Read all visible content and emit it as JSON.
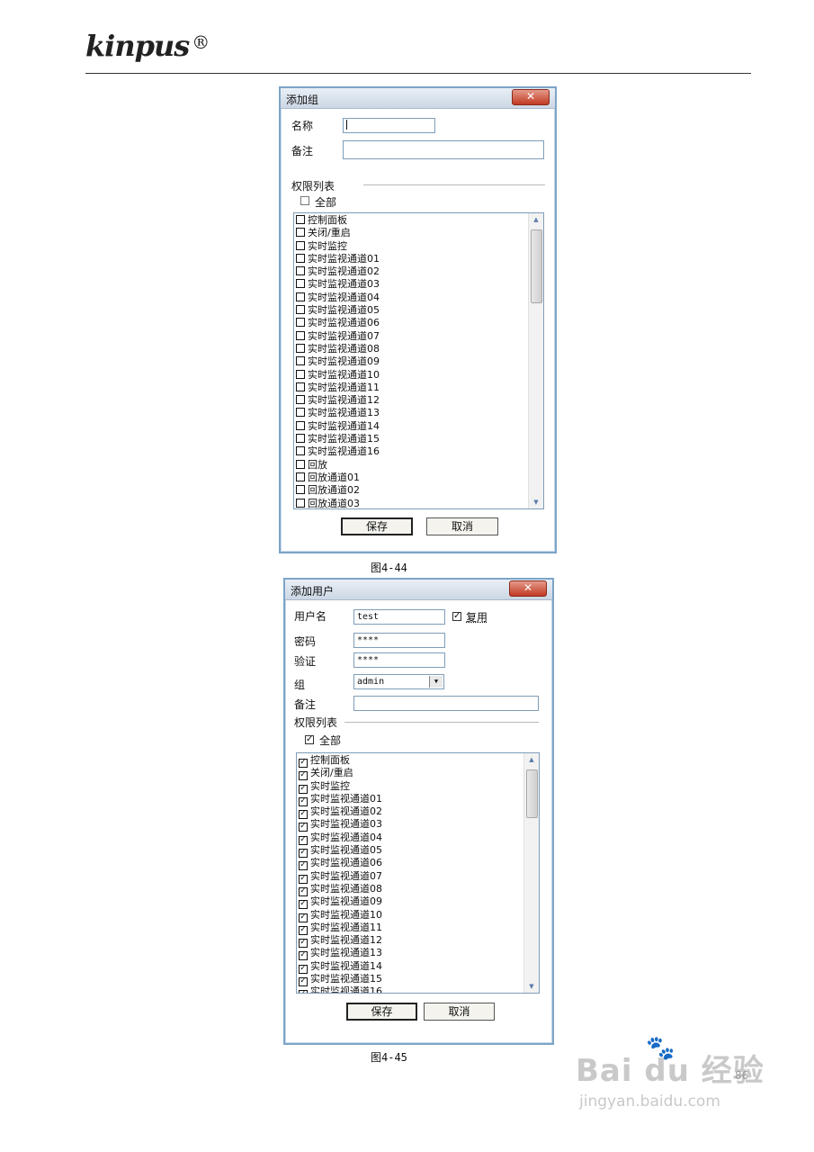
{
  "header": {
    "logo_text": "kinpus",
    "logo_mark": "®"
  },
  "dialog1": {
    "title": "添加组",
    "close_label": "✕",
    "name_label": "名称",
    "name_value": "",
    "note_label": "备注",
    "note_value": "",
    "perm_label": "权限列表",
    "all_label": "全部",
    "items": [
      "控制面板",
      "关闭/重启",
      "实时监控",
      "实时监视通道01",
      "实时监视通道02",
      "实时监视通道03",
      "实时监视通道04",
      "实时监视通道05",
      "实时监视通道06",
      "实时监视通道07",
      "实时监视通道08",
      "实时监视通道09",
      "实时监视通道10",
      "实时监视通道11",
      "实时监视通道12",
      "实时监视通道13",
      "实时监视通道14",
      "实时监视通道15",
      "实时监视通道16",
      "回放",
      "回放通道01",
      "回放通道02",
      "回放通道03"
    ],
    "save_label": "保存",
    "cancel_label": "取消"
  },
  "caption1": "图4-44",
  "dialog2": {
    "title": "添加用户",
    "close_label": "✕",
    "user_label": "用户名",
    "user_value": "test",
    "reuse_label": "复用",
    "pwd_label": "密码",
    "pwd_value": "****",
    "verify_label": "验证",
    "verify_value": "****",
    "group_label": "组",
    "group_value": "admin",
    "note_label": "备注",
    "note_value": "",
    "perm_label": "权限列表",
    "all_label": "全部",
    "items": [
      "控制面板",
      "关闭/重启",
      "实时监控",
      "实时监视通道01",
      "实时监视通道02",
      "实时监视通道03",
      "实时监视通道04",
      "实时监视通道05",
      "实时监视通道06",
      "实时监视通道07",
      "实时监视通道08",
      "实时监视通道09",
      "实时监视通道10",
      "实时监视通道11",
      "实时监视通道12",
      "实时监视通道13",
      "实时监视通道14",
      "实时监视通道15",
      "实时监视通道16"
    ],
    "save_label": "保存",
    "cancel_label": "取消"
  },
  "caption2": "图4-45",
  "watermark": {
    "brand": "Bai du 经验",
    "url": "jingyan.baidu.com"
  },
  "page_number": "86"
}
